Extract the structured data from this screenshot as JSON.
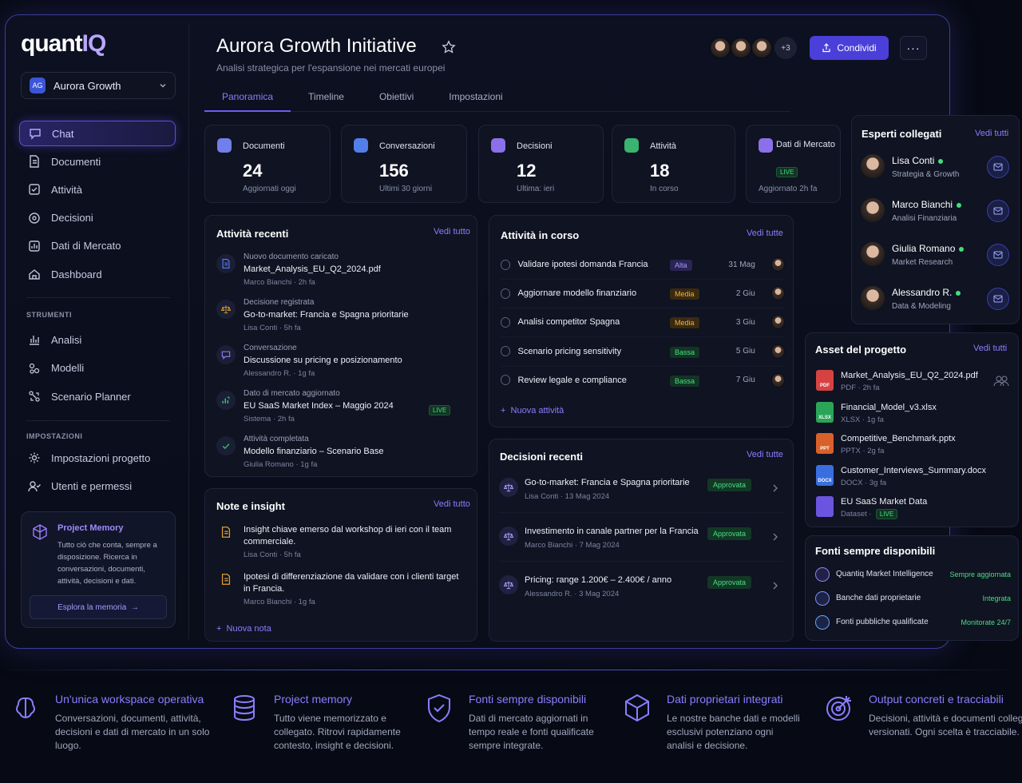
{
  "brand": {
    "logo_a": "quant",
    "logo_b": "IQ"
  },
  "workspace": {
    "initials": "AG",
    "name": "Aurora Growth"
  },
  "nav": [
    {
      "label": "Chat",
      "icon": "chat-icon"
    },
    {
      "label": "Documenti",
      "icon": "document-icon"
    },
    {
      "label": "Attività",
      "icon": "task-icon"
    },
    {
      "label": "Decisioni",
      "icon": "decision-icon"
    },
    {
      "label": "Dati di Mercato",
      "icon": "market-data-icon"
    },
    {
      "label": "Dashboard",
      "icon": "home-icon"
    }
  ],
  "tools": {
    "title": "STRUMENTI",
    "items": [
      {
        "label": "Analisi",
        "icon": "analytics-icon"
      },
      {
        "label": "Modelli",
        "icon": "models-icon"
      },
      {
        "label": "Scenario Planner",
        "icon": "scenario-icon"
      }
    ]
  },
  "settings": {
    "title": "IMPOSTAZIONI",
    "items": [
      {
        "label": "Impostazioni progetto",
        "icon": "gear-icon"
      },
      {
        "label": "Utenti e permessi",
        "icon": "users-icon"
      }
    ]
  },
  "memory": {
    "title": "Project Memory",
    "desc": "Tutto ciò che conta, sempre a disposizione. Ricerca in conversazioni, documenti, attività, decisioni e dati.",
    "button": "Esplora la memoria"
  },
  "header": {
    "title": "Aurora Growth Initiative",
    "subtitle": "Analisi strategica per l'espansione nei mercati europei",
    "extra_count": "+3",
    "share": "Condividi"
  },
  "tabs": [
    "Panoramica",
    "Timeline",
    "Obiettivi",
    "Impostazioni"
  ],
  "stats": [
    {
      "label": "Documenti",
      "value": "24",
      "sub": "Aggiornati oggi",
      "color": "#7b8cff"
    },
    {
      "label": "Conversazioni",
      "value": "156",
      "sub": "Ultimi 30 giorni",
      "color": "#5a8cff"
    },
    {
      "label": "Decisioni",
      "value": "12",
      "sub": "Ultima: ieri",
      "color": "#9a7bff"
    },
    {
      "label": "Attività",
      "value": "18",
      "sub": "In corso",
      "color": "#3ec77a"
    },
    {
      "label": "Dati di Mercato",
      "live": "LIVE",
      "sub": "Aggiornato 2h fa",
      "color": "#9a7bff"
    }
  ],
  "recent": {
    "title": "Attività recenti",
    "link": "Vedi tutto",
    "items": [
      {
        "type": "Nuovo documento caricato",
        "title": "Market_Analysis_EU_Q2_2024.pdf",
        "meta": "Marco Bianchi · 2h fa",
        "icon": "document-icon",
        "color": "#5a7cff"
      },
      {
        "type": "Decisione registrata",
        "title": "Go-to-market: Francia e Spagna prioritarie",
        "meta": "Lisa Conti · 5h fa",
        "icon": "scale-icon",
        "color": "#e0a030"
      },
      {
        "type": "Conversazione",
        "title": "Discussione su pricing e posizionamento",
        "meta": "Alessandro R. · 1g fa",
        "icon": "chat-icon",
        "color": "#9a7bff"
      },
      {
        "type": "Dato di mercato aggiornato",
        "title": "EU SaaS Market Index – Maggio 2024",
        "meta": "Sistema · 2h fa",
        "icon": "chart-icon",
        "color": "#3ec77a",
        "live": "LIVE"
      },
      {
        "type": "Attività completata",
        "title": "Modello finanziario – Scenario Base",
        "meta": "Giulia Romano · 1g fa",
        "icon": "check-icon",
        "color": "#3ec77a"
      }
    ]
  },
  "inprogress": {
    "title": "Attività in corso",
    "link": "Vedi tutte",
    "add": "Nuova attività",
    "items": [
      {
        "title": "Validare ipotesi domanda Francia",
        "priority": "Alta",
        "cls": "b-alta",
        "date": "31 Mag"
      },
      {
        "title": "Aggiornare modello finanziario",
        "priority": "Media",
        "cls": "b-media",
        "date": "2 Giu"
      },
      {
        "title": "Analisi competitor Spagna",
        "priority": "Media",
        "cls": "b-media",
        "date": "3 Giu"
      },
      {
        "title": "Scenario pricing sensitivity",
        "priority": "Bassa",
        "cls": "b-bassa",
        "date": "5 Giu"
      },
      {
        "title": "Review legale e compliance",
        "priority": "Bassa",
        "cls": "b-bassa",
        "date": "7 Giu"
      }
    ]
  },
  "notes": {
    "title": "Note e insight",
    "link": "Vedi tutto",
    "add": "Nuova nota",
    "items": [
      {
        "text": "Insight chiave emerso dal workshop di ieri con il team commerciale.",
        "meta": "Lisa Conti · 5h fa"
      },
      {
        "text": "Ipotesi di differenziazione da validare con i clienti target in Francia.",
        "meta": "Marco Bianchi · 1g fa"
      }
    ]
  },
  "decisions": {
    "title": "Decisioni recenti",
    "link": "Vedi tutte",
    "items": [
      {
        "title": "Go-to-market: Francia e Spagna prioritarie",
        "meta": "Lisa Conti · 13 Mag 2024",
        "status": "Approvata"
      },
      {
        "title": "Investimento in canale partner per la Francia",
        "meta": "Marco Bianchi · 7 Mag 2024",
        "status": "Approvata"
      },
      {
        "title": "Pricing: range 1.200€ – 2.400€ / anno",
        "meta": "Alessandro R. · 3 Mag 2024",
        "status": "Approvata"
      }
    ]
  },
  "experts": {
    "title": "Esperti collegati",
    "link": "Vedi tutti",
    "items": [
      {
        "name": "Lisa Conti",
        "role": "Strategia & Growth"
      },
      {
        "name": "Marco Bianchi",
        "role": "Analisi Finanziaria"
      },
      {
        "name": "Giulia Romano",
        "role": "Market Research"
      },
      {
        "name": "Alessandro R.",
        "role": "Data & Modeling"
      }
    ]
  },
  "assets": {
    "title": "Asset del progetto",
    "link": "Vedi tutti",
    "items": [
      {
        "name": "Market_Analysis_EU_Q2_2024.pdf",
        "meta": "PDF · 2h fa",
        "tag": "PDF",
        "color": "#d64242"
      },
      {
        "name": "Financial_Model_v3.xlsx",
        "meta": "XLSX · 1g fa",
        "tag": "XLSX",
        "color": "#2aa558"
      },
      {
        "name": "Competitive_Benchmark.pptx",
        "meta": "PPTX · 2g fa",
        "tag": "PPT",
        "color": "#d8602a"
      },
      {
        "name": "Customer_Interviews_Summary.docx",
        "meta": "DOCX · 3g fa",
        "tag": "DOCX",
        "color": "#3a6ee0"
      },
      {
        "name": "EU SaaS Market Data",
        "meta": "Dataset ·",
        "live": "LIVE",
        "tag": "",
        "color": "#6a54e0"
      }
    ]
  },
  "sources": {
    "title": "Fonti sempre disponibili",
    "items": [
      {
        "name": "Quantiq Market Intelligence",
        "status": "Sempre aggiornata",
        "color": "#9a7bff"
      },
      {
        "name": "Banche dati proprietarie",
        "status": "Integrata",
        "color": "#7b8cff"
      },
      {
        "name": "Fonti pubbliche qualificate",
        "status": "Monitorate 24/7",
        "color": "#5aa8ff"
      }
    ]
  },
  "features": [
    {
      "title": "Un'unica workspace operativa",
      "desc": "Conversazioni, documenti, attività, decisioni e dati di mercato in un solo luogo.",
      "icon": "brain-icon"
    },
    {
      "title": "Project memory",
      "desc": "Tutto viene memorizzato e collegato. Ritrovi rapidamente contesto, insight e decisioni.",
      "icon": "database-icon"
    },
    {
      "title": "Fonti sempre disponibili",
      "desc": "Dati di mercato aggiornati in tempo reale e fonti qualificate sempre integrate.",
      "icon": "shield-icon"
    },
    {
      "title": "Dati proprietari integrati",
      "desc": "Le nostre banche dati e modelli esclusivi potenziano ogni analisi e decisione.",
      "icon": "cube-icon"
    },
    {
      "title": "Output concreti e tracciabili",
      "desc": "Decisioni, attività e documenti collegati e versionati. Ogni scelta è tracciabile.",
      "icon": "target-icon"
    }
  ]
}
